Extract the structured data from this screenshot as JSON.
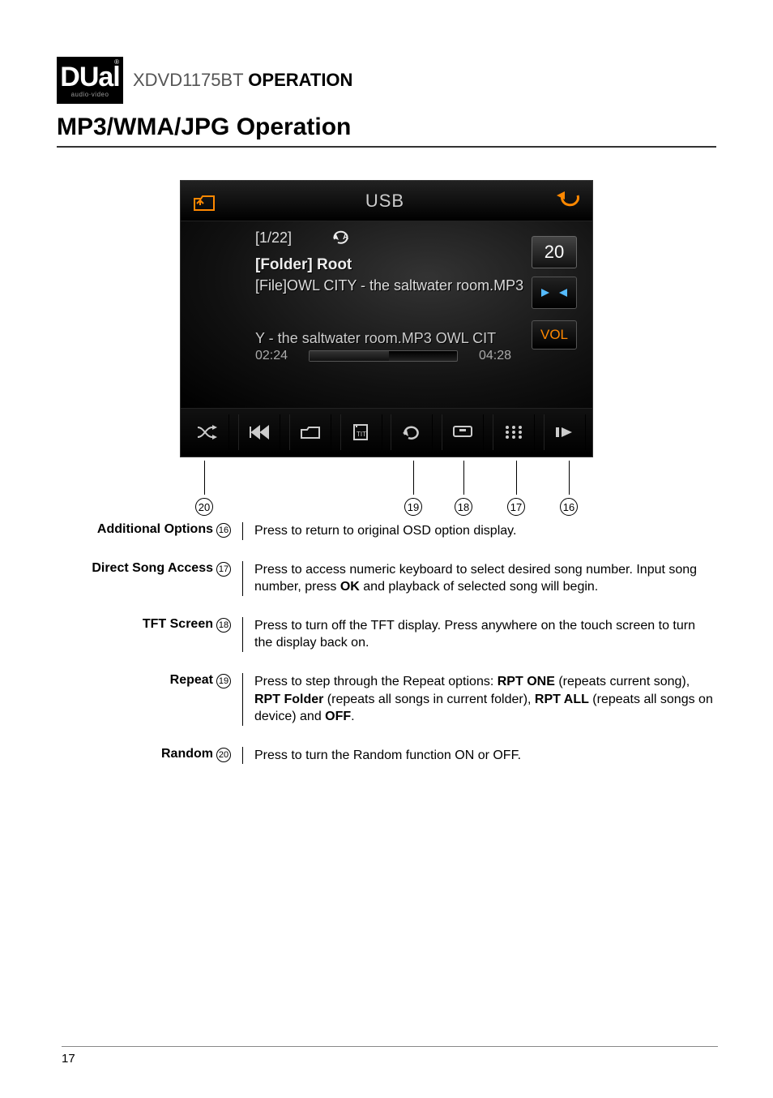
{
  "header": {
    "logo_main": "DUal",
    "logo_sub": "audio·video",
    "logo_reg": "®",
    "product": "XDVD1175BT",
    "operation": "OPERATION"
  },
  "title": "MP3/WMA/JPG Operation",
  "screenshot": {
    "topbar_title": "USB",
    "track_index": "[1/22]",
    "folder_line": "[Folder] Root",
    "file_line": "[File]OWL CITY - the saltwater room.MP3",
    "scrolling_title": "Y - the saltwater room.MP3  OWL CIT",
    "time_elapsed": "02:24",
    "time_total": "04:28",
    "side_number": "20",
    "side_vol": "VOL"
  },
  "callouts": {
    "c20": "20",
    "c19": "19",
    "c18": "18",
    "c17": "17",
    "c16": "16"
  },
  "descriptions": [
    {
      "label": "Additional Options",
      "num": "16",
      "text": "Press to return to original OSD option display."
    },
    {
      "label": "Direct Song Access",
      "num": "17",
      "text_parts": [
        "Press to access numeric keyboard to select desired song number. Input song number, press ",
        "OK",
        " and playback of selected song will begin."
      ]
    },
    {
      "label": "TFT Screen",
      "num": "18",
      "text": "Press to turn off the TFT display. Press anywhere on the touch screen to turn the display back on."
    },
    {
      "label": "Repeat",
      "num": "19",
      "text_parts": [
        "Press to step through the Repeat options: ",
        "RPT ONE",
        " (repeats current song), ",
        "RPT Folder",
        " (repeats all songs in current folder), ",
        "RPT ALL",
        " (repeats all songs on device) and ",
        "OFF",
        "."
      ]
    },
    {
      "label": "Random",
      "num": "20",
      "text": "Press to turn the Random function ON or OFF."
    }
  ],
  "page_number": "17"
}
